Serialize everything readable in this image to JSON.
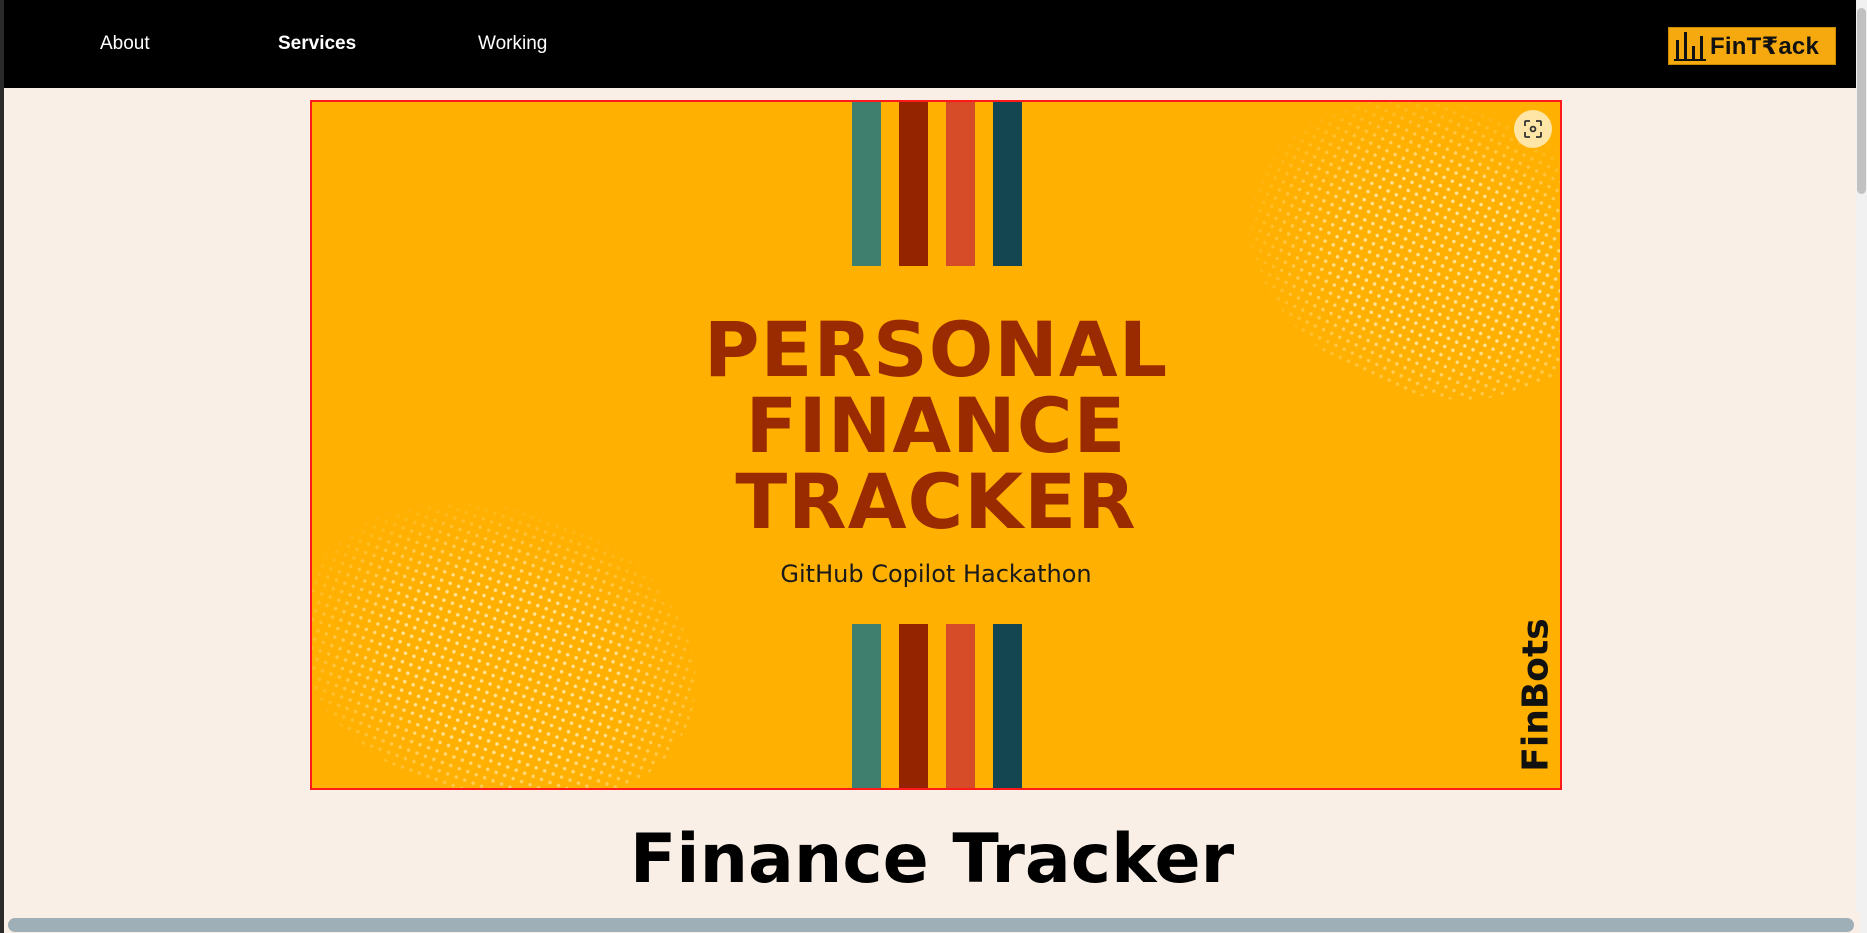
{
  "navbar": {
    "links": [
      {
        "label": "About"
      },
      {
        "label": "Services"
      },
      {
        "label": "Working"
      }
    ],
    "logo_text": "FinT₹ack"
  },
  "hero": {
    "title_lines": [
      "PERSONAL",
      "FINANCE",
      "TRACKER"
    ],
    "subtitle": "GitHub Copilot Hackathon",
    "team_label": "FinBots",
    "scan_icon": "scan-icon",
    "colors": {
      "background": "#ffb000",
      "title": "#9a2a00",
      "stripe_teal": "#3e7f6e",
      "stripe_maroon": "#942400",
      "stripe_orange": "#d64b28",
      "stripe_navy": "#134650",
      "selection_border": "#ff1a1a"
    }
  },
  "page": {
    "heading": "Finance Tracker"
  }
}
